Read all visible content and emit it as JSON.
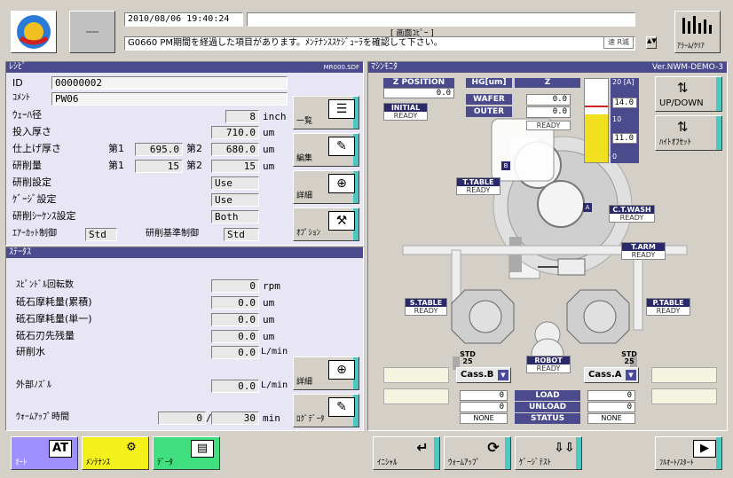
{
  "header": {
    "datetime": "2010/08/06 19:40:24",
    "screen_copy": "[ 画面ｺﾋﾟｰ ]",
    "message": "G0660 PM期間を経過した項目があります。ﾒﾝﾃﾅﾝｽｽｹｼﾞｭｰﾗを確認して下さい。",
    "speed_label": "速 R滅",
    "alarm_label": "ｱﾗｰﾑ/ｸﾘｱ"
  },
  "recipe": {
    "title": "ﾚｼﾋﾟ",
    "file": "MR000.SDF",
    "id_label": "ID",
    "id_value": "00000002",
    "comment_label": "ｺﾒﾝﾄ",
    "comment_value": "PW06",
    "wafer_dia_label": "ｳｪｰﾊ径",
    "wafer_dia_value": "8",
    "wafer_dia_unit": "inch",
    "input_thick_label": "投入厚さ",
    "input_thick_value": "710.0",
    "input_thick_unit": "um",
    "finish_thick_label": "仕上げ厚さ",
    "finish_first_label": "第1",
    "finish_first_value": "695.0",
    "finish_second_label": "第2",
    "finish_second_value": "680.0",
    "finish_unit": "um",
    "grind_amount_label": "研削量",
    "grind_first_label": "第1",
    "grind_first_value": "15",
    "grind_second_label": "第2",
    "grind_second_value": "15",
    "grind_unit": "um",
    "grind_setting_label": "研削設定",
    "grind_setting_value": "Use",
    "gauge_setting_label": "ｹﾞｰｼﾞ設定",
    "gauge_setting_value": "Use",
    "sequence_label": "研削ｼｰｹﾝｽ設定",
    "sequence_value": "Both",
    "aircut_label": "ｴｱｰｶｯﾄ制御",
    "aircut_value": "Std",
    "grind_ref_label": "研削基準制御",
    "grind_ref_value": "Std",
    "btn_list": "一覧",
    "btn_edit": "編集",
    "btn_detail": "詳細",
    "btn_option": "ｵﾌﾟｼｮﾝ"
  },
  "status": {
    "title": "ｽﾃｰﾀｽ",
    "spindle_label": "ｽﾋﾟﾝﾄﾞﾙ回転数",
    "spindle_value": "0",
    "spindle_unit": "rpm",
    "wear_total_label": "砥石摩耗量(累積)",
    "wear_total_value": "0.0",
    "wear_total_unit": "um",
    "wear_single_label": "砥石摩耗量(単一)",
    "wear_single_value": "0.0",
    "wear_single_unit": "um",
    "tip_remain_label": "砥石刃先残量",
    "tip_remain_value": "0.0",
    "tip_remain_unit": "um",
    "grind_water_label": "研削水",
    "grind_water_value": "0.0",
    "grind_water_unit": "L/min",
    "ext_nozzle_label": "外部ﾉｽﾞﾙ",
    "ext_nozzle_value": "0.0",
    "ext_nozzle_unit": "L/min",
    "warmup_label": "ｳｫｰﾑｱｯﾌﾟ時間",
    "warmup_elapsed": "0",
    "warmup_sep": "/",
    "warmup_total": "30",
    "warmup_unit": "min",
    "btn_detail": "詳細",
    "btn_log": "ﾛｸﾞﾃﾞｰﾀ"
  },
  "machine": {
    "title": "ﾏｼﾝﾓﾆﾀ",
    "version": "Ver.NWM-DEMO-3",
    "zpos_label": "Z POSITION",
    "zpos_value": "0.0",
    "hg_label": "HG[um]",
    "z_label": "Z",
    "wafer_label": "WAFER",
    "wafer_value": "0.0",
    "outer_label": "OUTER",
    "outer_value": "0.0",
    "ready": "READY",
    "initial_label": "INITIAL",
    "bar_top_label": "20 [A]",
    "bar_val1": "14.0",
    "bar_mid_label": "10",
    "bar_val2": "11.0",
    "bar_zero": "0",
    "updown_label": "UP/DOWN",
    "height_offset_label": "ﾊｲﾄｵﾌｾｯﾄ",
    "ttable_label": "T.TABLE",
    "ctwash_label": "C.T.WASH",
    "tarm_label": "T.ARM",
    "stable_label": "S.TABLE",
    "ptable_label": "P.TABLE",
    "robot_label": "ROBOT",
    "marker_a": "A",
    "marker_b": "B",
    "std_b": "STD 25",
    "std_a": "STD 25",
    "cass_b": "Cass.B",
    "cass_a": "Cass.A",
    "cass_b_load": "0",
    "cass_b_unload": "0",
    "cass_a_load": "0",
    "cass_a_unload": "0",
    "load_label": "LOAD",
    "unload_label": "UNLOAD",
    "status_label": "STATUS",
    "none": "NONE"
  },
  "bottom": {
    "auto": "ｵｰﾄ",
    "auto_icon": "AT",
    "maintenance": "ﾒﾝﾃﾅﾝｽ",
    "data": "ﾃﾞｰﾀ",
    "initial": "ｲﾆｼｬﾙ",
    "warmup": "ｳｫｰﾑｱｯﾌﾟ",
    "gauge_test": "ｹﾞｰｼﾞﾃｽﾄ",
    "full_auto": "ﾌﾙｵｰﾄ/ｽﾀｰﾄ"
  }
}
